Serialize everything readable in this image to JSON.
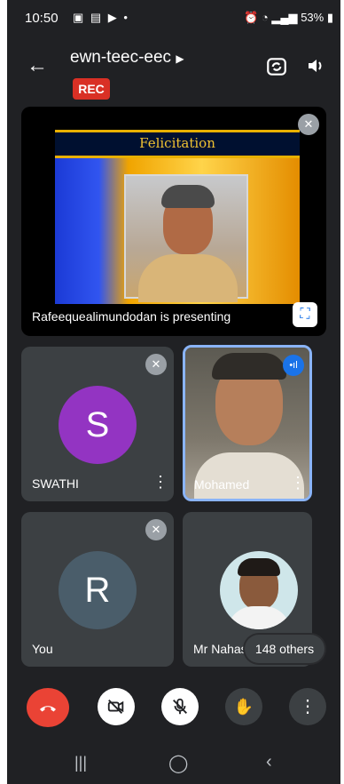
{
  "status": {
    "time": "10:50",
    "battery": "53%"
  },
  "meeting": {
    "title": "ewn-teec-eec",
    "rec_label": "REC"
  },
  "presentation": {
    "slide_title": "Felicitation",
    "presenter_text": "Rafeequealimundodan is presenting"
  },
  "participants": {
    "swathi": {
      "initial": "S",
      "name": "SWATHI",
      "color": "#9334c2"
    },
    "mohamed": {
      "name": "Mohamed"
    },
    "you": {
      "initial": "R",
      "name": "You",
      "color": "#4a5d6a"
    },
    "nahas": {
      "name": "Mr Nahas"
    },
    "others": "148 others"
  },
  "controls": {
    "end_call_color": "#ea4335"
  },
  "icons": {
    "back": "arrow-left-icon",
    "camera_switch": "camera-switch-icon",
    "speaker": "speaker-icon"
  }
}
